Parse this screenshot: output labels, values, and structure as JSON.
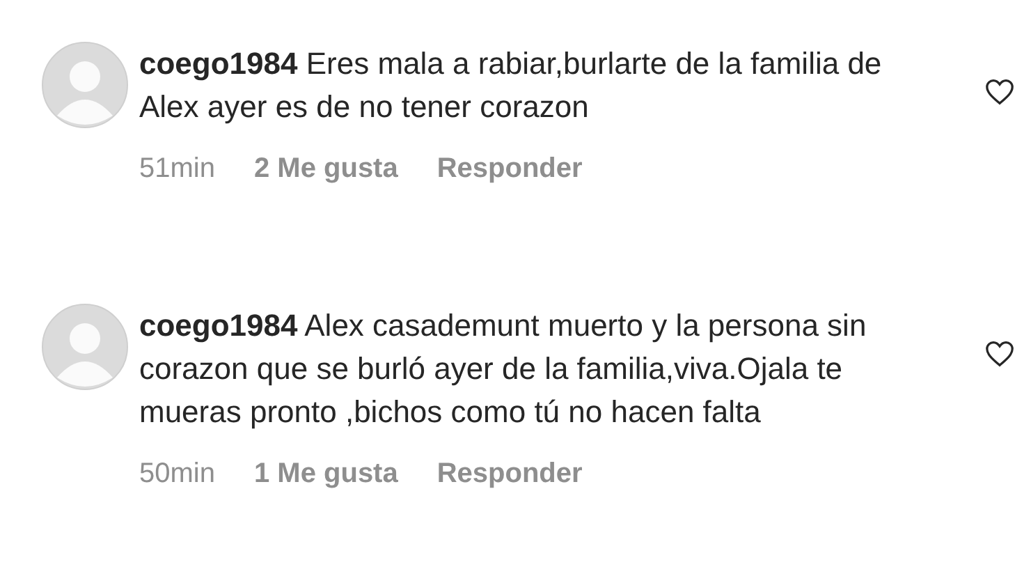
{
  "comments": [
    {
      "text": "**coego1984** Eres mala a rabiar,burlarte de la familia de Alex ayer es de no tener corazon",
      "time": "51min",
      "likes": "2 Me gusta",
      "reply": "Responder",
      "liked": false
    },
    {
      "text": "**coego1984** Alex casademunt muerto y la persona sin corazon que se burló ayer de la familia,viva.Ojala te mueras pronto ,bichos como tú no hacen falta",
      "time": "50min",
      "likes": "1 Me gusta",
      "reply": "Responder",
      "liked": false
    }
  ]
}
